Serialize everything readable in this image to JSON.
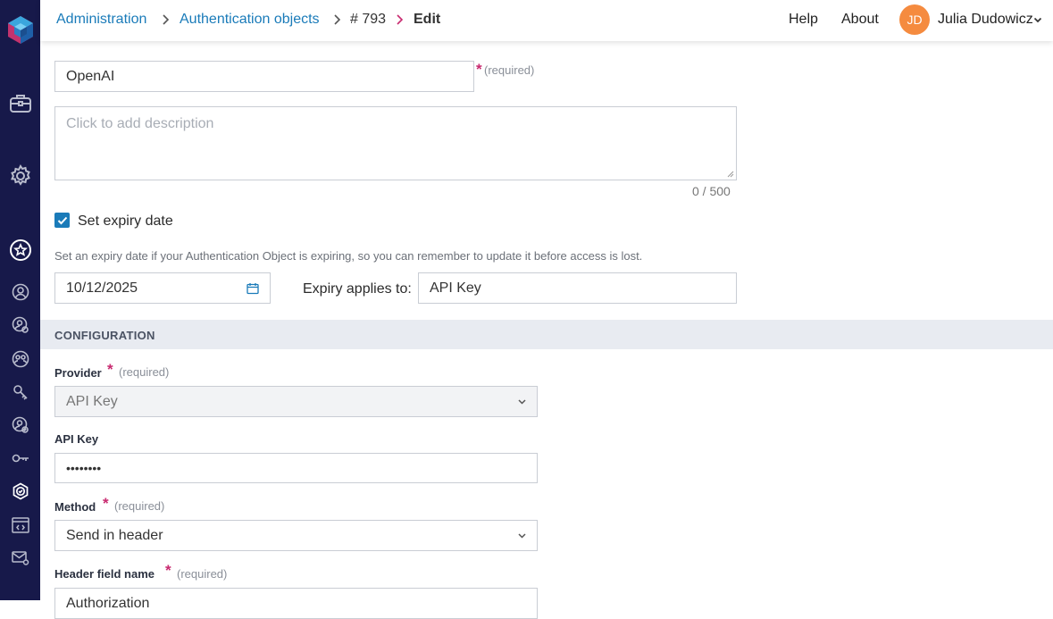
{
  "breadcrumb": {
    "items": [
      "Administration",
      "Authentication objects",
      "# 793",
      "Edit"
    ]
  },
  "header": {
    "help": "Help",
    "about": "About",
    "user_initials": "JD",
    "user_name": "Julia Dudowicz"
  },
  "form": {
    "name_value": "OpenAI",
    "required_text": "(required)",
    "description_placeholder": "Click to add description",
    "char_counter": "0 / 500",
    "expiry_checkbox_label": "Set expiry date",
    "expiry_checked": true,
    "expiry_hint": "Set an expiry date if your Authentication Object is expiring, so you can remember to update it before access is lost.",
    "expiry_date": "10/12/2025",
    "expiry_applies_label": "Expiry applies to:",
    "expiry_applies_value": "API Key"
  },
  "configuration": {
    "section_title": "CONFIGURATION",
    "provider_label": "Provider",
    "provider_value": "API Key",
    "api_key_label": "API Key",
    "api_key_value": "••••••••",
    "method_label": "Method",
    "method_value": "Send in header",
    "header_field_label": "Header field name",
    "header_field_value": "Authorization"
  },
  "sidebar": {
    "icons": [
      "app-logo",
      "briefcase",
      "settings-gear",
      "user-star",
      "user",
      "user-settings",
      "users-group",
      "key-tool",
      "user-check",
      "key",
      "shield-check",
      "code-window",
      "mail-settings"
    ]
  },
  "colors": {
    "sidebar_bg": "#17194a",
    "link": "#1a7bb9",
    "required_star": "#c8296f",
    "avatar": "#f58b3f",
    "section_bar": "#e8ebf1"
  }
}
